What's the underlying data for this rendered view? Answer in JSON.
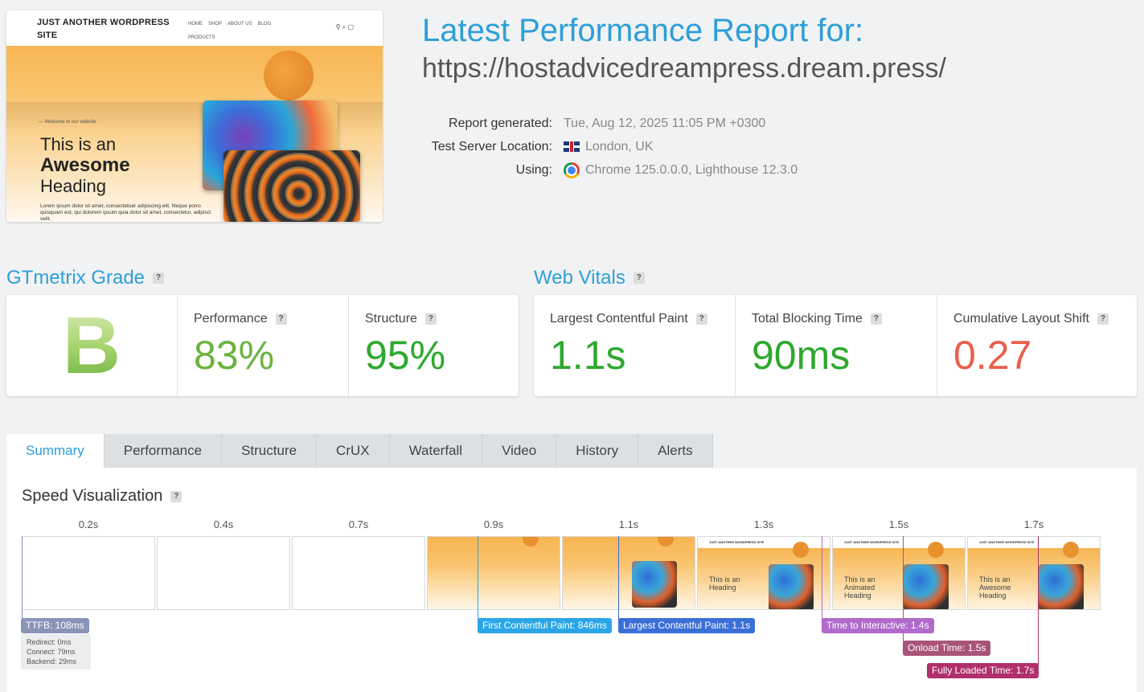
{
  "thumbnail": {
    "site_title": "JUST ANOTHER WORDPRESS SITE",
    "menu": [
      "HOME",
      "SHOP",
      "ABOUT US",
      "BLOG",
      "PRODUCTS"
    ],
    "kicker": "Welcome to our website",
    "heading_line1": "This is an",
    "heading_line2": "Awesome",
    "heading_line3": "Heading",
    "lorem": "Lorem ipsum dolor sit amet, consectetuer adipiscing elit. Neque porro quisquam est, qui dolorem ipsum quia dolor sit amet, consectetur, adipisci velit."
  },
  "report": {
    "title": "Latest Performance Report for:",
    "url": "https://hostadvicedreampress.dream.press/",
    "generated_label": "Report generated:",
    "generated_value": "Tue, Aug 12, 2025 11:05 PM +0300",
    "location_label": "Test Server Location:",
    "location_value": "London, UK",
    "using_label": "Using:",
    "using_value": "Chrome 125.0.0.0, Lighthouse 12.3.0"
  },
  "grade": {
    "section_title": "GTmetrix Grade",
    "letter": "B",
    "performance_label": "Performance",
    "performance_value": "83%",
    "structure_label": "Structure",
    "structure_value": "95%"
  },
  "vitals": {
    "section_title": "Web Vitals",
    "lcp_label": "Largest Contentful Paint",
    "lcp_value": "1.1s",
    "tbt_label": "Total Blocking Time",
    "tbt_value": "90ms",
    "cls_label": "Cumulative Layout Shift",
    "cls_value": "0.27"
  },
  "colors": {
    "accent": "#2d9fd9",
    "good": "#6cb33f",
    "excellent": "#2ea82e",
    "poor": "#e8604c"
  },
  "tabs": [
    "Summary",
    "Performance",
    "Structure",
    "CrUX",
    "Waterfall",
    "Video",
    "History",
    "Alerts"
  ],
  "summary": {
    "speed_title": "Speed Visualization",
    "frame_times": [
      "0.2s",
      "0.4s",
      "0.7s",
      "0.9s",
      "1.1s",
      "1.3s",
      "1.5s",
      "1.7s"
    ],
    "frame_headings": [
      "",
      "",
      "",
      "",
      "",
      "This is an Heading",
      "This is an Animated Heading",
      "This is an Awesome Heading"
    ],
    "markers": {
      "ttfb": "TTFB: 108ms",
      "fcp": "First Contentful Paint: 846ms",
      "lcp": "Largest Contentful Paint: 1.1s",
      "tti": "Time to Interactive: 1.4s",
      "onload": "Onload Time: 1.5s",
      "fully_loaded": "Fully Loaded Time: 1.7s"
    },
    "ttfb_detail": {
      "redirect": "Redirect: 0ms",
      "connect": "Connect: 79ms",
      "backend": "Backend: 29ms"
    }
  }
}
